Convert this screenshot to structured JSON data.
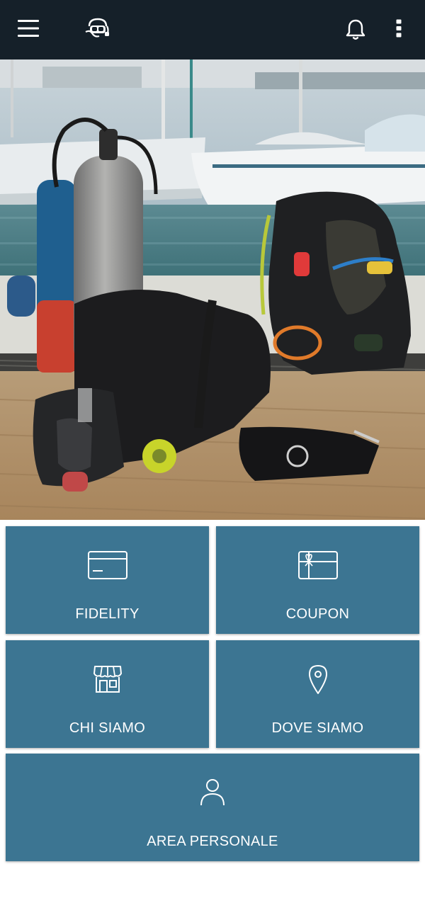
{
  "app": {
    "logo_icon": "diver-mask-logo-icon",
    "menu_icon": "hamburger-menu-icon",
    "notification_icon": "bell-icon",
    "overflow_icon": "more-vertical-icon"
  },
  "hero": {
    "image_description_icon": "scuba-gear-photo"
  },
  "tiles": [
    {
      "label": "FIDELITY",
      "icon": "card-icon"
    },
    {
      "label": "COUPON",
      "icon": "gift-card-icon"
    },
    {
      "label": "CHI SIAMO",
      "icon": "store-icon"
    },
    {
      "label": "DOVE SIAMO",
      "icon": "location-pin-icon"
    },
    {
      "label": "AREA PERSONALE",
      "icon": "user-icon"
    }
  ],
  "colors": {
    "topbar": "#152029",
    "tile": "#3c7592",
    "tile_text": "#ffffff"
  }
}
